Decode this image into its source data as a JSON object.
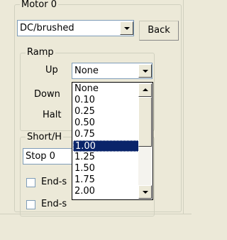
{
  "motor_group": {
    "title": "Motor 0",
    "type_select": {
      "value": "DC/brushed"
    },
    "back_button": "Back"
  },
  "ramp_group": {
    "title": "Ramp",
    "up_label": "Up",
    "down_label": "Down",
    "halt_label": "Halt",
    "up_select": {
      "value": "None"
    }
  },
  "short_group": {
    "title_visible": "Short/H",
    "stop_select": {
      "value": "Stop 0"
    },
    "checkbox1_label_visible": "End-s",
    "checkbox2_label_visible": "End-s"
  },
  "dropdown": {
    "options": [
      "None",
      "0.10",
      "0.25",
      "0.50",
      "0.75",
      "1.00",
      "1.25",
      "1.50",
      "1.75",
      "2.00"
    ],
    "selected_index": 5
  }
}
